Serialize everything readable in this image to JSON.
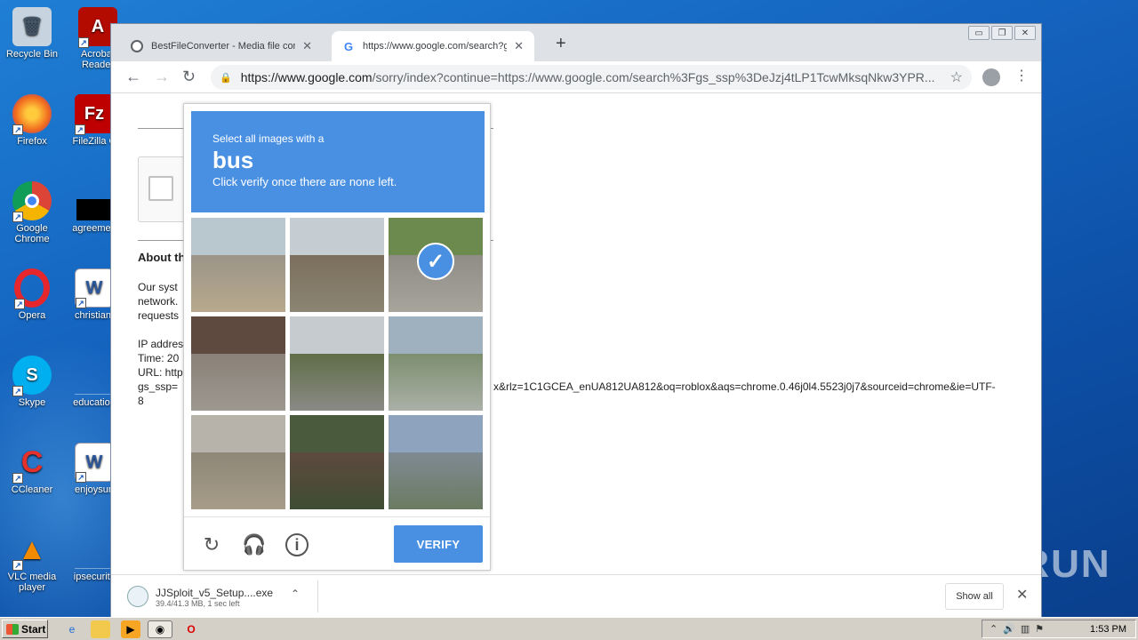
{
  "desktop": {
    "icons": [
      {
        "label": "Recycle Bin"
      },
      {
        "label": "Acrobat Reader"
      },
      {
        "label": "Firefox"
      },
      {
        "label": "FileZilla C"
      },
      {
        "label": "Google Chrome"
      },
      {
        "label": "agreemen"
      },
      {
        "label": "Opera"
      },
      {
        "label": "christianf"
      },
      {
        "label": "Skype"
      },
      {
        "label": "education"
      },
      {
        "label": "CCleaner"
      },
      {
        "label": "enjoysun"
      },
      {
        "label": "VLC media player"
      },
      {
        "label": "ipsecurity"
      }
    ],
    "watermark": "ANY RUN"
  },
  "browser": {
    "tabs": [
      {
        "title": "BestFileConverter - Media file conver",
        "close": "✕"
      },
      {
        "title": "https://www.google.com/search?gs_",
        "close": "✕"
      }
    ],
    "new_tab": "+",
    "window_buttons": [
      "▭",
      "❐",
      "✕"
    ],
    "url_host": "https://www.google.com",
    "url_rest": "/sorry/index?continue=https://www.google.com/search%3Fgs_ssp%3DeJzj4tLP1TcwMksqNkw3YPR..."
  },
  "page": {
    "about_heading": "About th",
    "para_lines": [
      "Our syst",
      "network.",
      "requests"
    ],
    "ip_line": "IP addres",
    "time_line": "Time: 20",
    "url_line": "URL: http",
    "ssp_line": "gs_ssp=",
    "ssp_tail": "x&rlz=1C1GCEA_enUA812UA812&oq=roblox&aqs=chrome.0.46j0l4.5523j0j7&sourceid=chrome&ie=UTF-",
    "last_line": "8"
  },
  "captcha": {
    "instruction_small": "Select all images with a",
    "target": "bus",
    "instruction_sub": "Click verify once there are none left.",
    "selected_tiles": [
      2
    ],
    "verify_label": "VERIFY"
  },
  "download": {
    "filename": "JJSploit_v5_Setup....exe",
    "status": "39.4/41.3 MB, 1 sec left",
    "show_all": "Show all"
  },
  "taskbar": {
    "start_label": "Start",
    "clock": "1:53 PM"
  }
}
